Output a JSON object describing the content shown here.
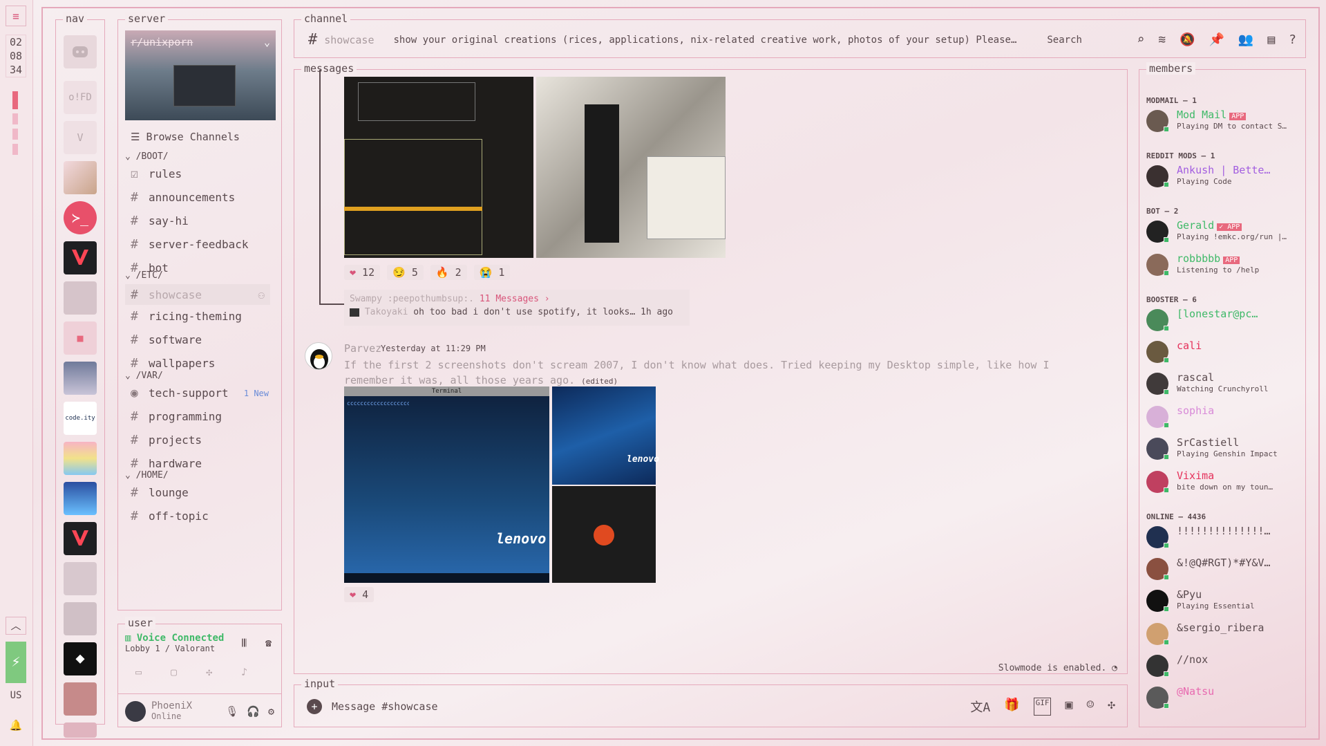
{
  "strip": {
    "menu_icon": "hamburger-icon",
    "clock": [
      "02",
      "08",
      "34"
    ],
    "lang": "US"
  },
  "nav": {
    "legend": "nav"
  },
  "server": {
    "legend": "server",
    "name": "r/unixporn",
    "browse": "Browse Channels",
    "categories": [
      {
        "label": "/BOOT/",
        "channels": [
          {
            "name": "rules",
            "icon": "rules-icon"
          },
          {
            "name": "announcements",
            "icon": "hash-icon"
          },
          {
            "name": "say-hi",
            "icon": "hash-icon"
          },
          {
            "name": "server-feedback",
            "icon": "hash-icon"
          },
          {
            "name": "bot",
            "icon": "hash-icon"
          }
        ]
      },
      {
        "label": "/ETC/",
        "channels": [
          {
            "name": "showcase",
            "icon": "hash-icon",
            "selected": true
          },
          {
            "name": "ricing-theming",
            "icon": "hash-icon"
          },
          {
            "name": "software",
            "icon": "hash-icon"
          },
          {
            "name": "wallpapers",
            "icon": "hash-icon"
          }
        ]
      },
      {
        "label": "/VAR/",
        "channels": [
          {
            "name": "tech-support",
            "icon": "forum-icon",
            "badge": "1 New"
          },
          {
            "name": "programming",
            "icon": "hash-icon"
          },
          {
            "name": "projects",
            "icon": "hash-icon"
          },
          {
            "name": "hardware",
            "icon": "hash-icon"
          }
        ]
      },
      {
        "label": "/HOME/",
        "channels": [
          {
            "name": "lounge",
            "icon": "hash-icon"
          },
          {
            "name": "off-topic",
            "icon": "hash-icon"
          }
        ]
      }
    ]
  },
  "user": {
    "legend": "user",
    "voice_status": "Voice Connected",
    "voice_location": "Lobby 1 / Valorant",
    "username": "PhoeniX",
    "presence": "Online"
  },
  "channel": {
    "legend": "channel",
    "name": "showcase",
    "topic": "show your original creations (rices, applications, nix-related creative work, photos of your setup) Please do n…",
    "search_label": "Search"
  },
  "messages": {
    "legend": "messages",
    "reactions1": [
      {
        "emoji": "❤",
        "count": "12"
      },
      {
        "emoji": "😏",
        "count": "5"
      },
      {
        "emoji": "🔥",
        "count": "2"
      },
      {
        "emoji": "😭",
        "count": "1"
      }
    ],
    "thread": {
      "title": "Swampy :peepothumbsup:.",
      "count": "11 Messages ›",
      "last_author": "Takoyaki",
      "last_text": "oh too bad i don't use spotify, it looks…",
      "ago": "1h ago"
    },
    "post": {
      "author": "Parvez",
      "time": "Yesterday at 11:29 PM",
      "text": "If the first 2 screenshots don't scream 2007, I don't know what does. Tried keeping my Desktop simple, like how I remember it was, all those years ago.",
      "edited": "(edited)",
      "reaction": {
        "emoji": "❤",
        "count": "4"
      },
      "brand": "lenovo",
      "terminal_title": "Terminal"
    },
    "slowmode": "Slowmode is enabled."
  },
  "input": {
    "legend": "input",
    "placeholder": "Message #showcase",
    "gif": "GIF"
  },
  "members": {
    "legend": "members",
    "groups": [
      {
        "label": "MODMAIL — 1",
        "members": [
          {
            "name": "Mod Mail",
            "tag": "APP",
            "status": "Playing DM to contact S…",
            "color": "#3fb968"
          }
        ]
      },
      {
        "label": "REDDIT MODS — 1",
        "members": [
          {
            "name": "Ankush | Bette…",
            "status": "Playing Code",
            "color": "#a25ee0"
          }
        ]
      },
      {
        "label": "BOT — 2",
        "members": [
          {
            "name": "Gerald",
            "tag": "✓ APP",
            "status": "Playing !emkc.org/run |…",
            "color": "#3fb968"
          },
          {
            "name": "robbbbb",
            "tag": "APP",
            "status": "Listening to /help",
            "color": "#3fb968"
          }
        ]
      },
      {
        "label": "BOOSTER — 6",
        "members": [
          {
            "name": "[lonestar@pc…",
            "status": "",
            "color": "#3fb968"
          },
          {
            "name": "cali",
            "status": "",
            "color": "#e5305a"
          },
          {
            "name": "rascal",
            "status": "Watching Crunchyroll",
            "color": "#5a4a4e"
          },
          {
            "name": "sophia",
            "status": "",
            "color": "#d88ad8"
          },
          {
            "name": "SrCastiell",
            "status": "Playing Genshin Impact",
            "color": "#5a4a4e"
          },
          {
            "name": "Vixima",
            "status": "bite down on my toun…",
            "color": "#e5305a"
          }
        ]
      },
      {
        "label": "ONLINE — 4436",
        "members": [
          {
            "name": "!!!!!!!!!!!!!!…",
            "status": "",
            "color": "#5a4a4e"
          },
          {
            "name": "&!@Q#RGT)*#Y&V…",
            "status": "",
            "color": "#5a4a4e"
          },
          {
            "name": "&Pyu",
            "status": "Playing Essential",
            "color": "#5a4a4e"
          },
          {
            "name": "&sergio_ribera",
            "status": "",
            "color": "#5a4a4e"
          },
          {
            "name": "//nox",
            "status": "",
            "color": "#5a4a4e"
          },
          {
            "name": "@Natsu",
            "status": "",
            "color": "#e86ab0"
          }
        ]
      }
    ]
  }
}
